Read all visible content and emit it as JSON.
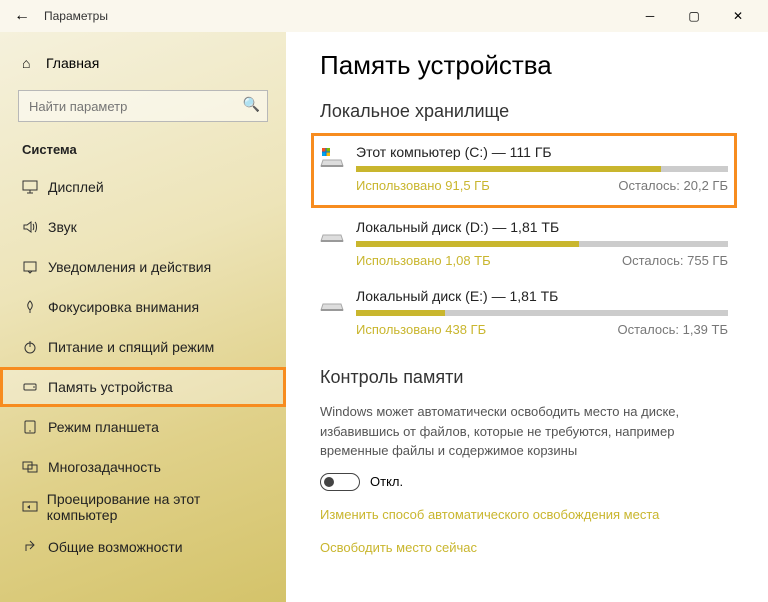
{
  "titlebar": {
    "back": "←",
    "title": "Параметры"
  },
  "sidebar": {
    "home": "Главная",
    "search_placeholder": "Найти параметр",
    "section": "Система",
    "items": [
      {
        "icon": "display",
        "label": "Дисплей"
      },
      {
        "icon": "sound",
        "label": "Звук"
      },
      {
        "icon": "notify",
        "label": "Уведомления и действия"
      },
      {
        "icon": "focus",
        "label": "Фокусировка внимания"
      },
      {
        "icon": "power",
        "label": "Питание и спящий режим"
      },
      {
        "icon": "storage",
        "label": "Память устройства",
        "active": true,
        "highlighted": true
      },
      {
        "icon": "tablet",
        "label": "Режим планшета"
      },
      {
        "icon": "multitask",
        "label": "Многозадачность"
      },
      {
        "icon": "project",
        "label": "Проецирование на этот компьютер"
      },
      {
        "icon": "shared",
        "label": "Общие возможности"
      }
    ]
  },
  "content": {
    "heading": "Память устройства",
    "local_storage": "Локальное хранилище",
    "drives": [
      {
        "title": "Этот компьютер (C:) — 111 ГБ",
        "used": "Использовано 91,5 ГБ",
        "remain": "Осталось: 20,2 ГБ",
        "pct": 82,
        "highlighted": true,
        "os": true
      },
      {
        "title": "Локальный диск (D:) — 1,81 ТБ",
        "used": "Использовано 1,08 ТБ",
        "remain": "Осталось: 755 ГБ",
        "pct": 60
      },
      {
        "title": "Локальный диск (E:) — 1,81 ТБ",
        "used": "Использовано 438 ГБ",
        "remain": "Осталось: 1,39 ТБ",
        "pct": 24
      }
    ],
    "sense_heading": "Контроль памяти",
    "sense_desc": "Windows может автоматически освободить место на диске, избавившись от файлов, которые не требуются, например временные файлы и содержимое корзины",
    "toggle_label": "Откл.",
    "link1": "Изменить способ автоматического освобождения места",
    "link2": "Освободить место сейчас"
  }
}
